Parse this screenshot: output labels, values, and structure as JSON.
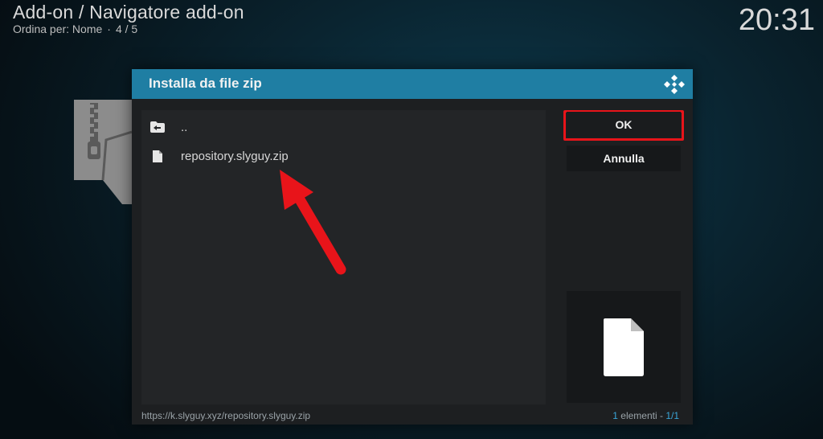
{
  "header": {
    "breadcrumb": "Add-on / Navigatore add-on",
    "sort_label": "Ordina per: Nome",
    "separator": "·",
    "position": "4 / 5",
    "clock": "20:31"
  },
  "background": {
    "icon": "zip-file-icon"
  },
  "dialog": {
    "title": "Installa da file zip",
    "logo_icon": "kodi-logo-icon",
    "header_color": "#1f7ea3",
    "items": [
      {
        "label": "..",
        "icon": "folder-back-icon"
      },
      {
        "label": "repository.slyguy.zip",
        "icon": "file-icon"
      }
    ],
    "buttons": {
      "ok": "OK",
      "cancel": "Annulla"
    },
    "highlight_color": "#e8141a",
    "thumbnail_icon": "file-icon",
    "footer": {
      "path": "https://k.slyguy.xyz/repository.slyguy.zip",
      "count_num": "1",
      "count_label": " elementi - ",
      "page": "1/1"
    }
  },
  "annotation": {
    "arrow_color": "#e8141a",
    "arrow_icon": "red-arrow-annotation"
  }
}
